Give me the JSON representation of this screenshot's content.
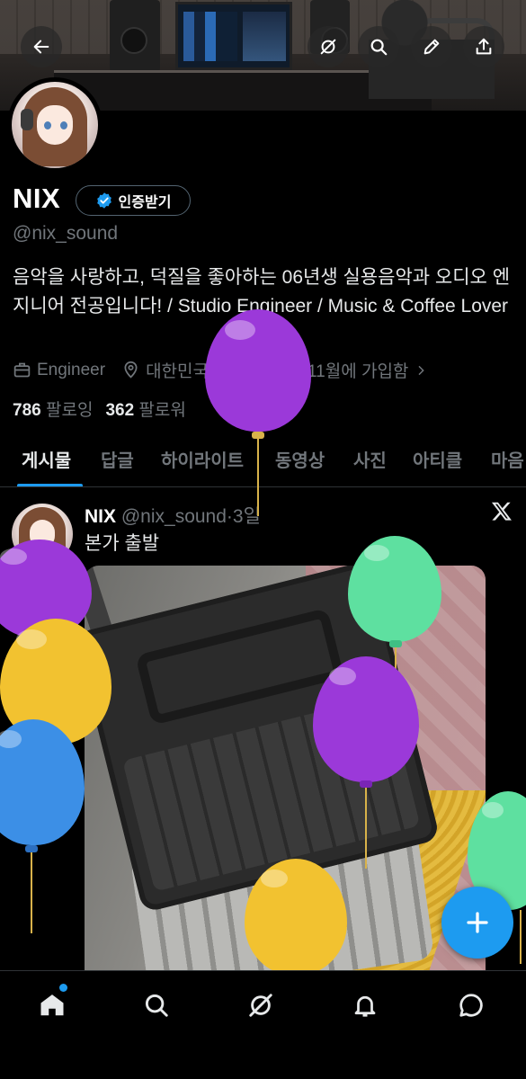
{
  "profile": {
    "name": "NIX",
    "verify_button_label": "인증받기",
    "handle": "@nix_sound",
    "bio": "음악을 사랑하고, 덕질을 좋아하는 06년생 실용음악과 오디오 엔지니어 전공입니다! / Studio Engineer / Music & Coffee Lover",
    "occupation": "Engineer",
    "location": "대한민국",
    "joined": "2020년 11월에 가입함",
    "following_count": "786",
    "following_label": "팔로잉",
    "followers_count": "362",
    "followers_label": "팔로워"
  },
  "header_buttons": {
    "back": "back-arrow-icon",
    "grok": "grok-icon",
    "search": "search-icon",
    "edit": "pencil-icon",
    "share": "share-icon"
  },
  "tabs": [
    {
      "label": "게시물",
      "active": true
    },
    {
      "label": "답글"
    },
    {
      "label": "하이라이트"
    },
    {
      "label": "동영상"
    },
    {
      "label": "사진"
    },
    {
      "label": "아티클"
    },
    {
      "label": "마음"
    }
  ],
  "post": {
    "author": "NIX",
    "handle": "@nix_sound",
    "separator": "·",
    "time": "3일",
    "text": "본가 출발",
    "platform_icon": "x-logo-icon"
  },
  "bottom_nav": [
    "home-icon",
    "search-icon",
    "grok-icon",
    "notifications-icon",
    "messages-icon"
  ],
  "colors": {
    "accent": "#1d9bf0",
    "background": "#000000",
    "secondary_text": "#71767b",
    "balloon_purple": "#9b39d9",
    "balloon_green": "#5ee0a0",
    "balloon_yellow": "#f2c230",
    "balloon_blue": "#3c8fe6"
  }
}
